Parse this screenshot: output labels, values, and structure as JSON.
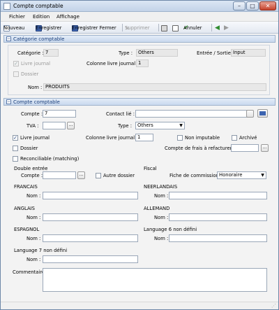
{
  "window": {
    "title": "Compte comptable",
    "min": "–",
    "max": "□",
    "close": "✕"
  },
  "menu": [
    "Fichier",
    "Edition",
    "Affichage"
  ],
  "toolbar": {
    "nouveau": "Nouveau",
    "enregistrer": "Enregistrer",
    "enregistrer_fermer": "Enregistrer Fermer",
    "supprimer": "Supprimer",
    "annuler": "Annuler"
  },
  "categorie": {
    "section_title": "Catégorie comptable",
    "categorie_label": "Catégorie :",
    "categorie_value": "7",
    "type_label": "Type :",
    "type_value": "Others",
    "entree_label": "Entrée / Sortie :",
    "entree_value": "Input",
    "livre_journal": "Livre journal",
    "colonne_label": "Colonne livre journal :",
    "colonne_value": "1",
    "dossier": "Dossier",
    "nom_label": "Nom :",
    "nom_value": "PRODUITS"
  },
  "compte": {
    "section_title": "Compte comptable",
    "compte_label": "Compte :",
    "compte_value": "7",
    "contact_label": "Contact lié :",
    "contact_value": "",
    "tva_label": "TVA :",
    "tva_value": "",
    "type_label": "Type :",
    "type_value": "Others",
    "livre_journal": "Livre journal",
    "colonne_label": "Colonne livre journal :",
    "colonne_value": "1",
    "non_imputable": "Non imputable",
    "archive": "Archivé",
    "dossier": "Dossier",
    "frais_label": "Compte de frais à refacturer :",
    "frais_value": "",
    "reconciliable": "Reconciliable (matching)",
    "double_entree": "Double entrée",
    "de_compte_label": "Compte :",
    "de_compte_value": "",
    "autre_dossier": "Autre dossier",
    "fiscal": "Fiscal",
    "fiche_label": "Fiche de commission",
    "fiche_value": "Honoraire",
    "francais": "FRANCAIS",
    "neerlandais": "NEERLANDAIS",
    "anglais": "ANGLAIS",
    "allemand": "ALLEMAND",
    "espagnol": "ESPAGNOL",
    "lang6": "Language 6 non défini",
    "lang7": "Language 7 non défini",
    "nom_label": "Nom :",
    "commentaire_label": "Commentaire",
    "browse": "..."
  },
  "colors": {
    "accent": "#1a3e7a",
    "section_bg": "#c9d9ee"
  }
}
